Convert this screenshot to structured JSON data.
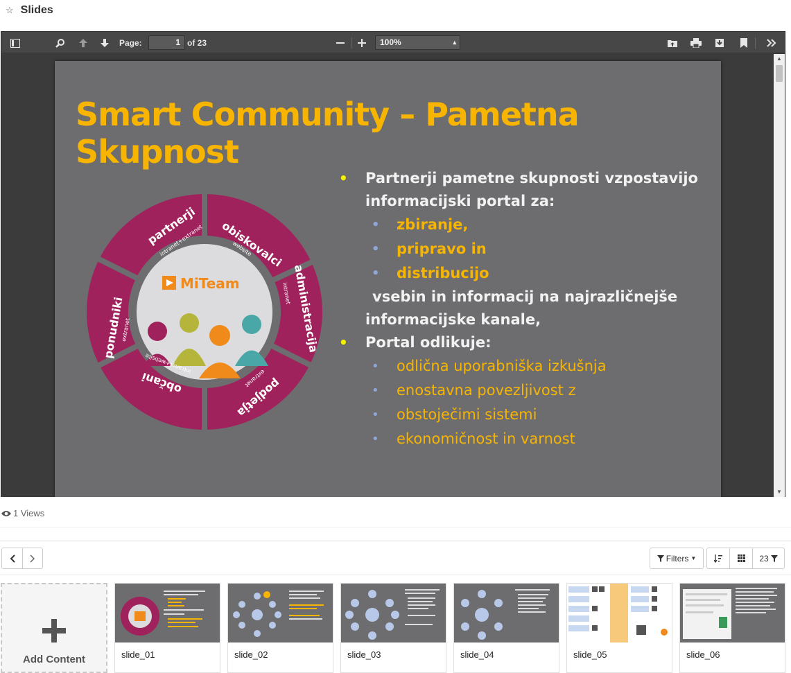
{
  "header": {
    "title": "Slides",
    "star_icon": "star-outline-icon"
  },
  "viewer": {
    "page_label": "Page:",
    "page_value": "1",
    "page_total": "of 23",
    "zoom_value": "100%",
    "slide": {
      "title": "Smart Community – Pametna Skupnost",
      "bullet1": "Partnerji pametne skupnosti vzpostavijo",
      "bullet1_cont": "informacijski portal za:",
      "sub1": [
        "zbiranje,",
        "pripravo in",
        "distribucijo"
      ],
      "cont_a": "vsebin in informacij na najrazličnejše",
      "cont_b": "informacijske kanale,",
      "bullet2": "Portal odlikuje:",
      "sub2": [
        "odlična uporabniška izkušnja",
        "enostavna povezljivost z",
        "ekonomičnost in varnost"
      ],
      "sub2_cont": "obstoječimi sistemi",
      "logo_text": "MiTeam",
      "ring_segments": [
        {
          "title": "partnerji",
          "sub": "intranet+extranet"
        },
        {
          "title": "obiskovalci",
          "sub": "website"
        },
        {
          "title": "administracija",
          "sub": "intranet"
        },
        {
          "title": "podjetja",
          "sub": "extranet"
        },
        {
          "title": "občani",
          "sub": "intranet+website"
        },
        {
          "title": "ponudniki",
          "sub": "extranet"
        }
      ]
    }
  },
  "views": {
    "text": "1 Views"
  },
  "toolbar_bottom": {
    "filters_label": "Filters",
    "count_label": "23"
  },
  "cards": {
    "add_label": "Add Content",
    "items": [
      "slide_01",
      "slide_02",
      "slide_03",
      "slide_04",
      "slide_05",
      "slide_06"
    ]
  },
  "colors": {
    "accent_yellow": "#f7b400",
    "ring_magenta": "#a0225c",
    "slide_bg": "#6d6d6f"
  }
}
